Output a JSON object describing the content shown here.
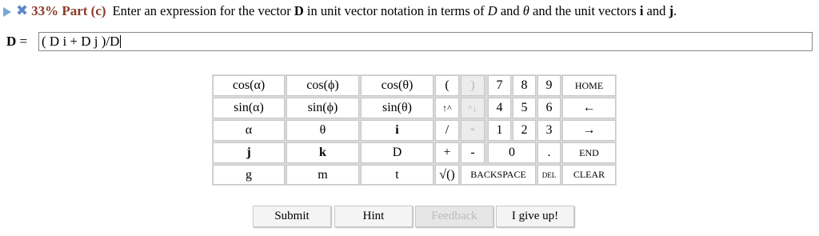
{
  "header": {
    "percent_part": "33% Part (c)",
    "prompt_pre": "Enter an expression for the vector ",
    "prompt_vec": "D",
    "prompt_mid": " in unit vector notation in terms of ",
    "prompt_D": "D",
    "prompt_and": " and ",
    "prompt_theta": "θ",
    "prompt_mid2": " and the unit vectors ",
    "prompt_i": "i",
    "prompt_and2": " and ",
    "prompt_j": "j",
    "prompt_end": "."
  },
  "answer": {
    "label_vec": "D",
    "label_eq": " = ",
    "value": "( D i + D j )/D"
  },
  "keypad": {
    "cos_alpha": "cos(α)",
    "cos_phi": "cos(ϕ)",
    "cos_theta": "cos(θ)",
    "sin_alpha": "sin(α)",
    "sin_phi": "sin(ϕ)",
    "sin_theta": "sin(θ)",
    "alpha": "α",
    "theta": "θ",
    "i": "i",
    "j": "j",
    "k": "k",
    "D": "D",
    "g": "g",
    "m": "m",
    "t": "t",
    "open_paren": "(",
    "close_paren": ")",
    "up_caret": "↑^",
    "down_caret": "^↓",
    "slash": "/",
    "star": "*",
    "plus": "+",
    "minus": "-",
    "sqrt": "√()",
    "backspace": "BACKSPACE",
    "n7": "7",
    "n8": "8",
    "n9": "9",
    "n4": "4",
    "n5": "5",
    "n6": "6",
    "n1": "1",
    "n2": "2",
    "n3": "3",
    "n0": "0",
    "dot": ".",
    "home": "HOME",
    "left": "←",
    "right": "→",
    "end": "END",
    "del": "DEL",
    "clear": "CLEAR"
  },
  "buttons": {
    "submit": "Submit",
    "hint": "Hint",
    "feedback": "Feedback",
    "give_up": "I give up!"
  }
}
